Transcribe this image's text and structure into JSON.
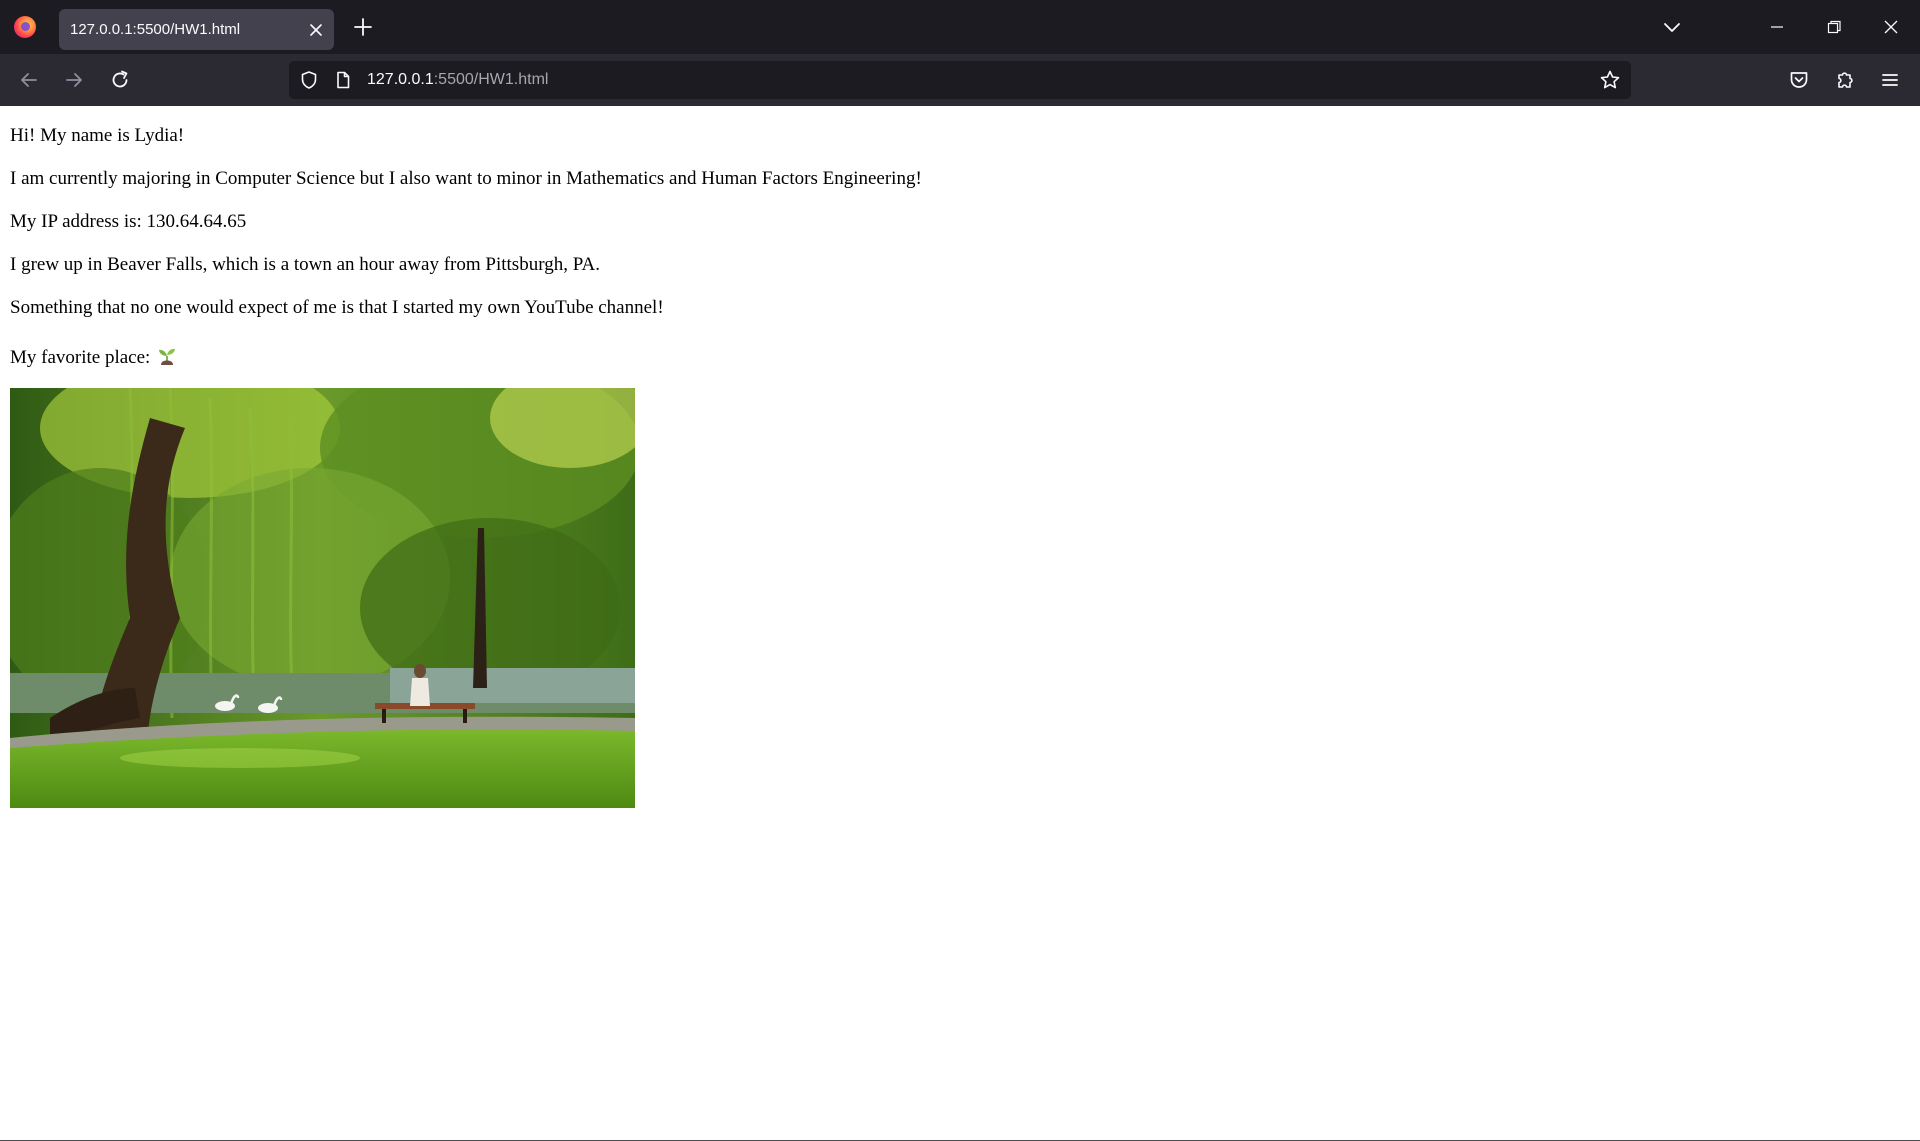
{
  "browser": {
    "tab": {
      "title": "127.0.0.1:5500/HW1.html"
    },
    "url": {
      "host": "127.0.0.1",
      "path": ":5500/HW1.html"
    },
    "colors": {
      "titlebar": "#1c1b22",
      "toolbar": "#2b2a33",
      "active_tab": "#42414d",
      "text": "#fbfbfe",
      "muted_text": "#a7a6ad"
    }
  },
  "page": {
    "intro": "Hi! My name is Lydia!",
    "major": "I am currently majoring in Computer Science but I also want to minor in Mathematics and Human Factors Engineering!",
    "ip": "My IP address is: 130.64.64.65",
    "hometown": "I grew up in Beaver Falls, which is a town an hour away from Pittsburgh, PA.",
    "surprise": "Something that no one would expect of me is that I started my own YouTube channel!",
    "favorite_place_label": "My favorite place:",
    "favorite_place_emoji": "seedling-icon",
    "photo": "park-with-willow-tree-pond-swans-and-bench"
  }
}
